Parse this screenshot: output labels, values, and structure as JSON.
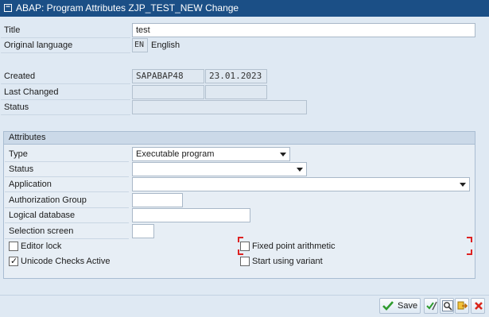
{
  "window": {
    "title": "ABAP: Program Attributes ZJP_TEST_NEW Change"
  },
  "header_fields": {
    "title": {
      "label": "Title",
      "value": "test"
    },
    "original_language": {
      "label": "Original language",
      "code": "EN",
      "name": "English"
    },
    "created": {
      "label": "Created",
      "user": "SAPABAP48",
      "date": "23.01.2023"
    },
    "last_changed": {
      "label": "Last Changed",
      "user": "",
      "date": ""
    },
    "status": {
      "label": "Status",
      "value": ""
    }
  },
  "attributes": {
    "header": "Attributes",
    "type": {
      "label": "Type",
      "value": "Executable program"
    },
    "status": {
      "label": "Status",
      "value": ""
    },
    "application": {
      "label": "Application",
      "value": ""
    },
    "authorization_group": {
      "label": "Authorization Group",
      "value": ""
    },
    "logical_database": {
      "label": "Logical database",
      "value": ""
    },
    "selection_screen": {
      "label": "Selection screen",
      "value": ""
    },
    "editor_lock": {
      "label": "Editor lock",
      "checked": false
    },
    "unicode_checks": {
      "label": "Unicode Checks Active",
      "checked": true
    },
    "fixed_point": {
      "label": "Fixed point arithmetic",
      "checked": false
    },
    "start_variant": {
      "label": "Start using variant",
      "checked": false
    }
  },
  "toolbar": {
    "save_label": "Save"
  },
  "colors": {
    "title_bar": "#1b4f86",
    "background": "#dfe9f3",
    "focus": "#dd2222",
    "check_green": "#2e9b2e",
    "cancel_red": "#d9261c"
  }
}
